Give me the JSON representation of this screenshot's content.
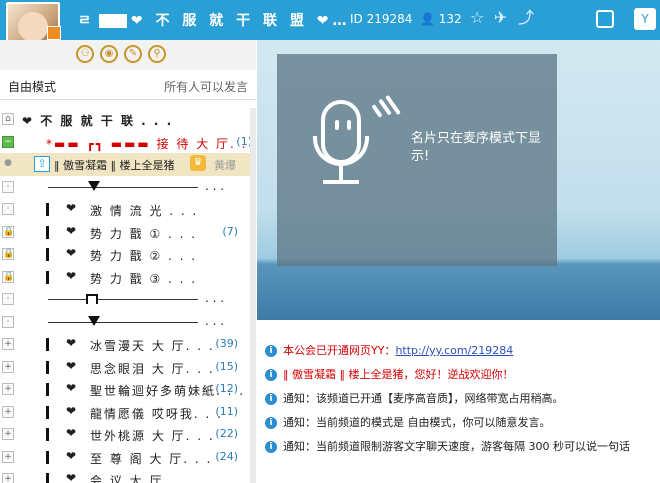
{
  "header": {
    "title_prefix": "ㄹ",
    "title_text": "❤ 不 服 就 干 联 盟 ❤…",
    "id_label": "ID 219284",
    "user_count": "132",
    "like_count": "0",
    "brand_color": "#2a9fd6"
  },
  "mode": {
    "label": "自由模式",
    "permission": "所有人可以发言"
  },
  "tree": {
    "root": "❤ 不 服 就 干 联 . . .",
    "reception": {
      "name": "接 待 大 厅. . .",
      "count": "(1)"
    },
    "user": {
      "name": "‖ 傲雪凝霜 ‖ 楼上全是猪",
      "tag": "黄爆"
    },
    "dots": ". . .",
    "channels": [
      {
        "name": "激 情 流 光 . . .",
        "count": ""
      },
      {
        "name": "势 力 戬 ① . . .",
        "count": "(7)"
      },
      {
        "name": "势 力 戬 ② . . .",
        "count": ""
      },
      {
        "name": "势 力 戬 ③ . . .",
        "count": ""
      }
    ],
    "channels2": [
      {
        "name": "冰雪漫天 大 厅. . .",
        "count": "(39)"
      },
      {
        "name": "思念眼泪 大 厅. . .",
        "count": "(15)"
      },
      {
        "name": "聖世輪迴好多萌妹紙. . .",
        "count": "(12)"
      },
      {
        "name": "龍情愿儀 哎呀我. . .",
        "count": "(11)"
      },
      {
        "name": "世外桃源 大 厅. . .",
        "count": "(22)"
      },
      {
        "name": "至 尊 阁 大 厅. . .",
        "count": "(24)"
      },
      {
        "name": "会 议 大 厅. . .",
        "count": ""
      }
    ]
  },
  "media": {
    "notice": "名片只在麦序模式下显示!"
  },
  "chat": {
    "messages": [
      {
        "prefix": "本公会已开通网页YY：",
        "link": "http://yy.com/219284",
        "style": "red"
      },
      {
        "prefix": "‖ 傲雪凝霜 ‖ 楼上全是猪，您好！逆战欢迎你！",
        "link": "",
        "style": "red"
      },
      {
        "prefix": "通知：该频道已开通【麦序高音质】，网络带宽占用稍高。",
        "link": "",
        "style": "normal"
      },
      {
        "prefix": "通知：当前频道的模式是 自由模式，你可以随意发言。",
        "link": "",
        "style": "normal"
      },
      {
        "prefix": "通知：当前频道限制游客文字聊天速度，游客每隔 300 秒可以说一句话",
        "link": "",
        "style": "normal"
      }
    ]
  }
}
